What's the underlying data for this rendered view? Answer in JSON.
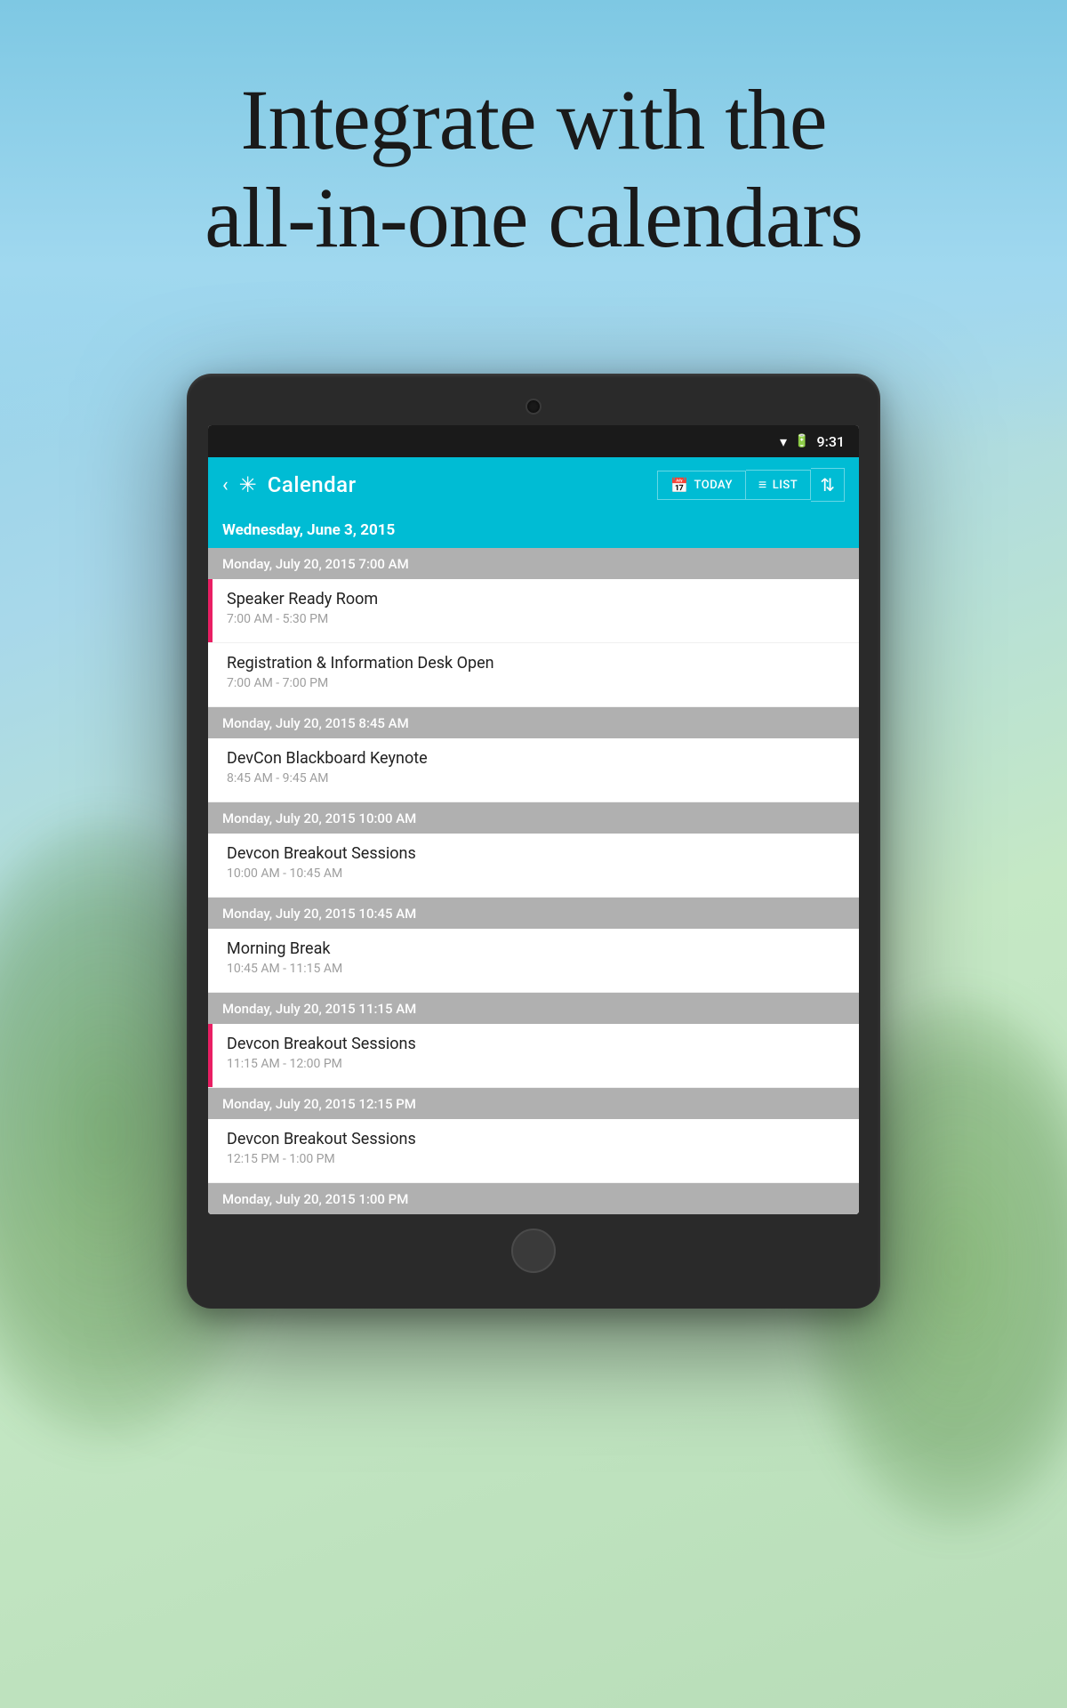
{
  "background": {
    "color_top": "#87CEEB",
    "color_bottom": "#b8ddb8"
  },
  "headline": {
    "line1": "Integrate with the",
    "line2": "all-in-one calendars"
  },
  "status_bar": {
    "time": "9:31",
    "wifi_icon": "wifi-icon",
    "battery_icon": "battery-icon"
  },
  "app_bar": {
    "back_label": "‹",
    "logo_label": "✳",
    "title": "Calendar",
    "today_label": "TODAY",
    "list_label": "LIST",
    "today_icon": "📅",
    "list_icon": "≡",
    "filter_icon": "⇅"
  },
  "current_date": {
    "text": "Wednesday, June 3, 2015"
  },
  "calendar_groups": [
    {
      "id": "group1",
      "header": "Monday, July 20, 2015 7:00 AM",
      "events": [
        {
          "id": "evt1",
          "title": "Speaker Ready Room",
          "time": "7:00 AM - 5:30 PM",
          "has_stripe": true
        },
        {
          "id": "evt2",
          "title": "Registration & Information Desk Open",
          "time": "7:00 AM - 7:00 PM",
          "has_stripe": false
        }
      ]
    },
    {
      "id": "group2",
      "header": "Monday, July 20, 2015 8:45 AM",
      "events": [
        {
          "id": "evt3",
          "title": "DevCon Blackboard Keynote",
          "time": "8:45 AM - 9:45 AM",
          "has_stripe": false
        }
      ]
    },
    {
      "id": "group3",
      "header": "Monday, July 20, 2015 10:00 AM",
      "events": [
        {
          "id": "evt4",
          "title": "Devcon Breakout Sessions",
          "time": "10:00 AM - 10:45 AM",
          "has_stripe": false
        }
      ]
    },
    {
      "id": "group4",
      "header": "Monday, July 20, 2015 10:45 AM",
      "events": [
        {
          "id": "evt5",
          "title": "Morning Break",
          "time": "10:45 AM - 11:15 AM",
          "has_stripe": false
        }
      ]
    },
    {
      "id": "group5",
      "header": "Monday, July 20, 2015 11:15 AM",
      "events": [
        {
          "id": "evt6",
          "title": "Devcon Breakout Sessions",
          "time": "11:15 AM - 12:00 PM",
          "has_stripe": true
        }
      ]
    },
    {
      "id": "group6",
      "header": "Monday, July 20, 2015 12:15 PM",
      "events": [
        {
          "id": "evt7",
          "title": "Devcon Breakout Sessions",
          "time": "12:15 PM - 1:00 PM",
          "has_stripe": false
        }
      ]
    },
    {
      "id": "group7",
      "header": "Monday, July 20, 2015 1:00 PM",
      "events": []
    }
  ]
}
